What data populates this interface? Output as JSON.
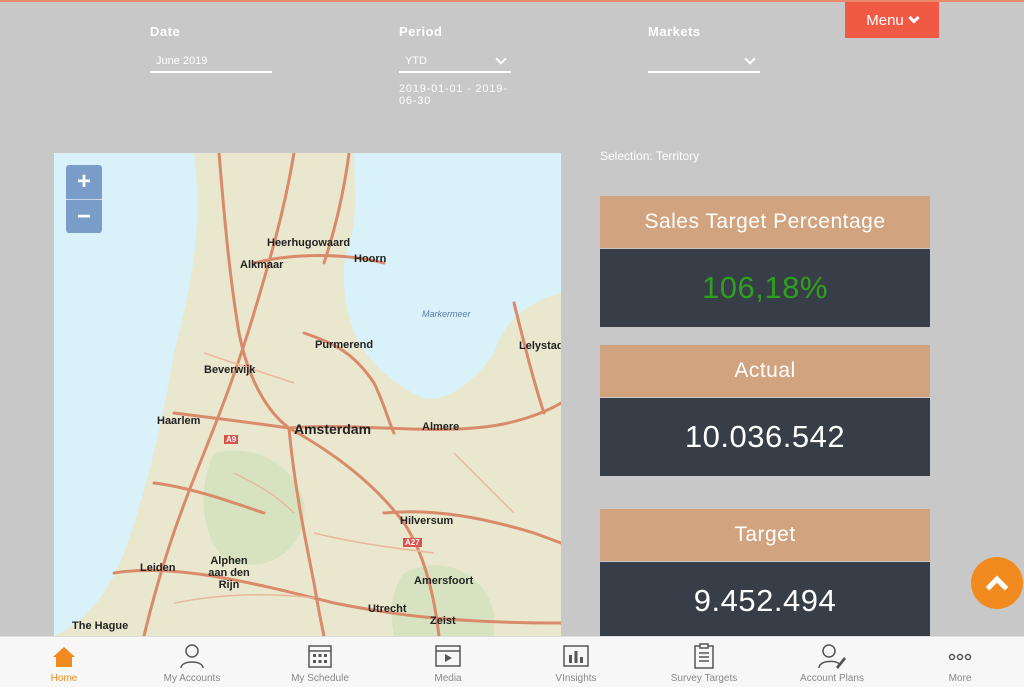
{
  "filters": {
    "date": {
      "label": "Date",
      "value": "June 2019"
    },
    "period": {
      "label": "Period",
      "value": "YTD",
      "range": "2019-01-01 - 2019-06-30"
    },
    "markets": {
      "label": "Markets",
      "value": ""
    }
  },
  "menu": {
    "label": "Menu"
  },
  "map": {
    "zoom_in": "+",
    "zoom_out": "−",
    "places": [
      "Heerhugowaard",
      "Alkmaar",
      "Hoorn",
      "Markermeer",
      "Purmerend",
      "Lelystad",
      "Beverwijk",
      "Haarlem",
      "Amsterdam",
      "Almere",
      "Hilversum",
      "Leiden",
      "Alphen aan den Rijn",
      "Amersfoort",
      "Utrecht",
      "Zeist",
      "The Hague",
      "A9",
      "A27"
    ]
  },
  "selection": "Selection: Territory",
  "kpis": [
    {
      "title": "Sales Target Percentage",
      "value": "106,18%"
    },
    {
      "title": "Actual",
      "value": "10.036.542"
    },
    {
      "title": "Target",
      "value": "9.452.494"
    }
  ],
  "tabs": [
    {
      "label": "Home",
      "icon": "home-icon"
    },
    {
      "label": "My Accounts",
      "icon": "accounts-icon"
    },
    {
      "label": "My Schedule",
      "icon": "calendar-icon"
    },
    {
      "label": "Media",
      "icon": "media-icon"
    },
    {
      "label": "VInsights",
      "icon": "chart-icon"
    },
    {
      "label": "Survey Targets",
      "icon": "clipboard-icon"
    },
    {
      "label": "Account Plans",
      "icon": "account-plan-icon"
    },
    {
      "label": "More",
      "icon": "more-icon"
    }
  ],
  "colors": {
    "accent": "#f05a44",
    "kpi_head": "#d1a37e",
    "kpi_body": "#373e47",
    "positive": "#2ea01d",
    "active_tab": "#f28b1f"
  }
}
